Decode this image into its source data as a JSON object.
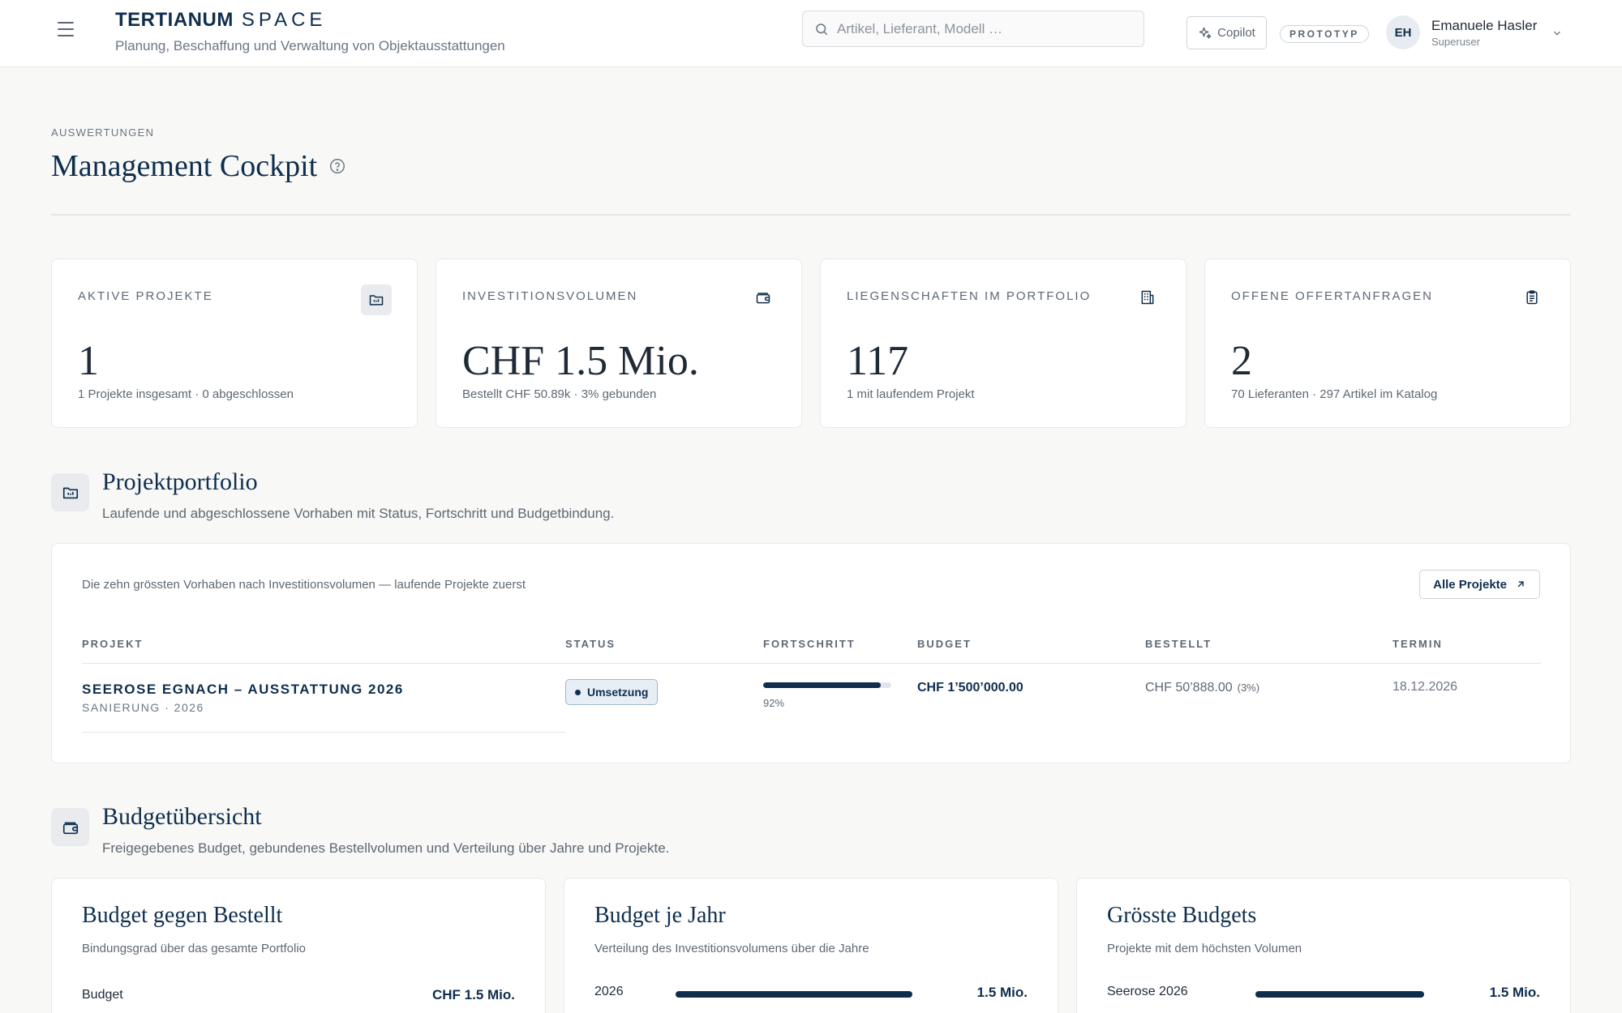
{
  "header": {
    "brand_primary": "TERTIANUM",
    "brand_secondary": "SPACE",
    "tagline": "Planung, Beschaffung und Verwaltung von Objektausstattungen",
    "search_placeholder": "Artikel, Lieferant, Modell …",
    "copilot_label": "Copilot",
    "badge": "PROTOTYP",
    "user": {
      "initials": "EH",
      "name": "Emanuele Hasler",
      "role": "Superuser"
    }
  },
  "page": {
    "eyebrow": "AUSWERTUNGEN",
    "title": "Management Cockpit"
  },
  "kpis": [
    {
      "label": "AKTIVE PROJEKTE",
      "value": "1",
      "sub": "1 Projekte insgesamt · 0 abgeschlossen",
      "icon": "folder-icon"
    },
    {
      "label": "INVESTITIONSVOLUMEN",
      "value": "CHF 1.5 Mio.",
      "sub": "Bestellt CHF 50.89k · 3% gebunden",
      "icon": "wallet-icon"
    },
    {
      "label": "LIEGENSCHAFTEN IM PORTFOLIO",
      "value": "117",
      "sub": "1 mit laufendem Projekt",
      "icon": "building-icon"
    },
    {
      "label": "OFFENE OFFERTANFRAGEN",
      "value": "2",
      "sub": "70 Lieferanten · 297 Artikel im Katalog",
      "icon": "clipboard-icon"
    }
  ],
  "portfolio": {
    "title": "Projektportfolio",
    "subtitle": "Laufende und abgeschlossene Vorhaben mit Status, Fortschritt und Budgetbindung.",
    "caption": "Die zehn grössten Vorhaben nach Investitionsvolumen — laufende Projekte zuerst",
    "all_button": "Alle Projekte",
    "columns": [
      "PROJEKT",
      "STATUS",
      "FORTSCHRITT",
      "BUDGET",
      "BESTELLT",
      "TERMIN"
    ],
    "rows": [
      {
        "name": "SEEROSE EGNACH – AUSSTATTUNG 2026",
        "meta": "SANIERUNG · 2026",
        "status": "Umsetzung",
        "progress": 0.92,
        "progress_label": "92%",
        "budget": "CHF 1’500’000.00",
        "ordered": "CHF 50’888.00",
        "ordered_pct": "(3%)",
        "deadline": "18.12.2026"
      }
    ]
  },
  "budget": {
    "title": "Budgetübersicht",
    "subtitle": "Freigegebenes Budget, gebundenes Bestellvolumen und Verteilung über Jahre und Projekte.",
    "cards": [
      {
        "title": "Budget gegen Bestellt",
        "sub": "Bindungsgrad über das gesamte Portfolio",
        "label": "Budget",
        "value": "CHF 1.5 Mio.",
        "bar": null
      },
      {
        "title": "Budget je Jahr",
        "sub": "Verteilung des Investitionsvolumens über die Jahre",
        "label": "2026",
        "value": "1.5 Mio.",
        "bar": 1.0
      },
      {
        "title": "Grösste Budgets",
        "sub": "Projekte mit dem höchsten Volumen",
        "label": "Seerose 2026",
        "value": "1.5 Mio.",
        "bar": 1.0
      }
    ]
  },
  "colors": {
    "primary": "#0f2e4e",
    "background": "#f8f8f6",
    "badge_bg": "#e7eef6"
  }
}
